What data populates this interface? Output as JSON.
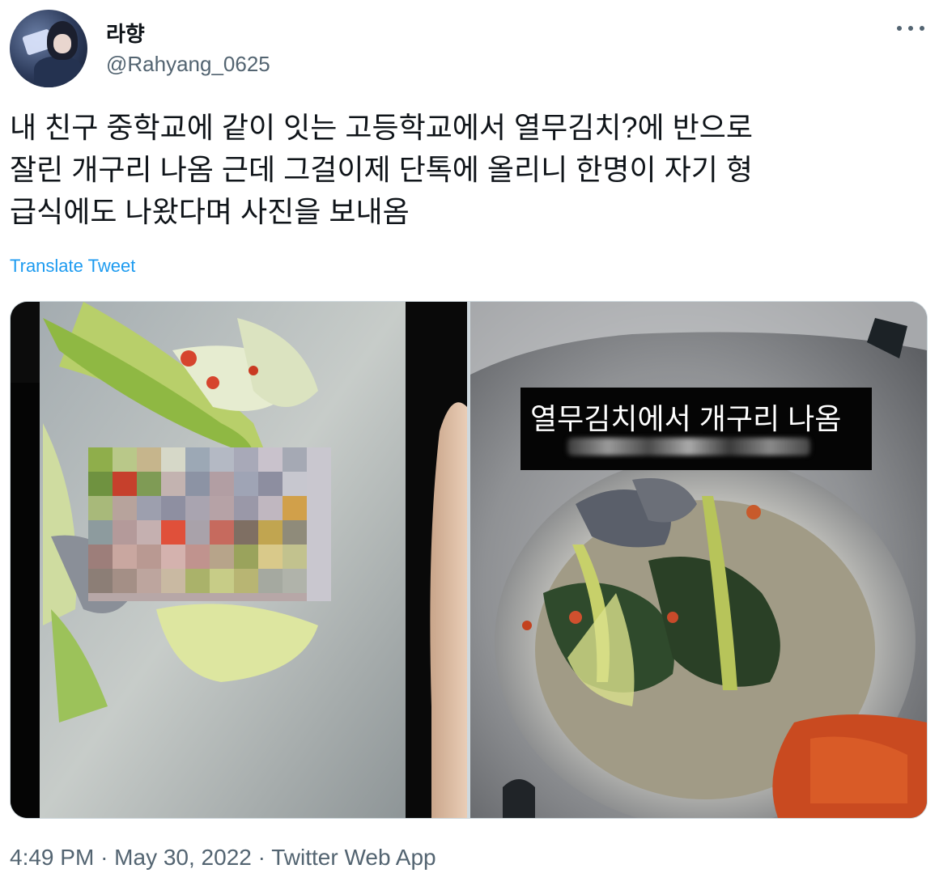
{
  "tweet": {
    "author_name": "라향",
    "author_handle": "@Rahyang_0625",
    "text_lines": [
      "내 친구 중학교에 같이 잇는 고등학교에서 열무김치?에 반으로",
      "잘린 개구리 나옴 근데 그걸이제 단톡에 올리니 한명이 자기 형",
      "급식에도 나왔다며 사진을 보내옴"
    ],
    "translate_label": "Translate Tweet",
    "image_caption": "열무김치에서 개구리 나옴",
    "time": "4:49 PM",
    "date": "May 30, 2022",
    "source": "Twitter Web App",
    "separator": "·"
  },
  "colors": {
    "accent": "#1d9bf0",
    "secondary_text": "#536471",
    "primary_text": "#0f1419",
    "border": "#cfd9de"
  },
  "icons": {
    "more": "more-dots-icon"
  }
}
